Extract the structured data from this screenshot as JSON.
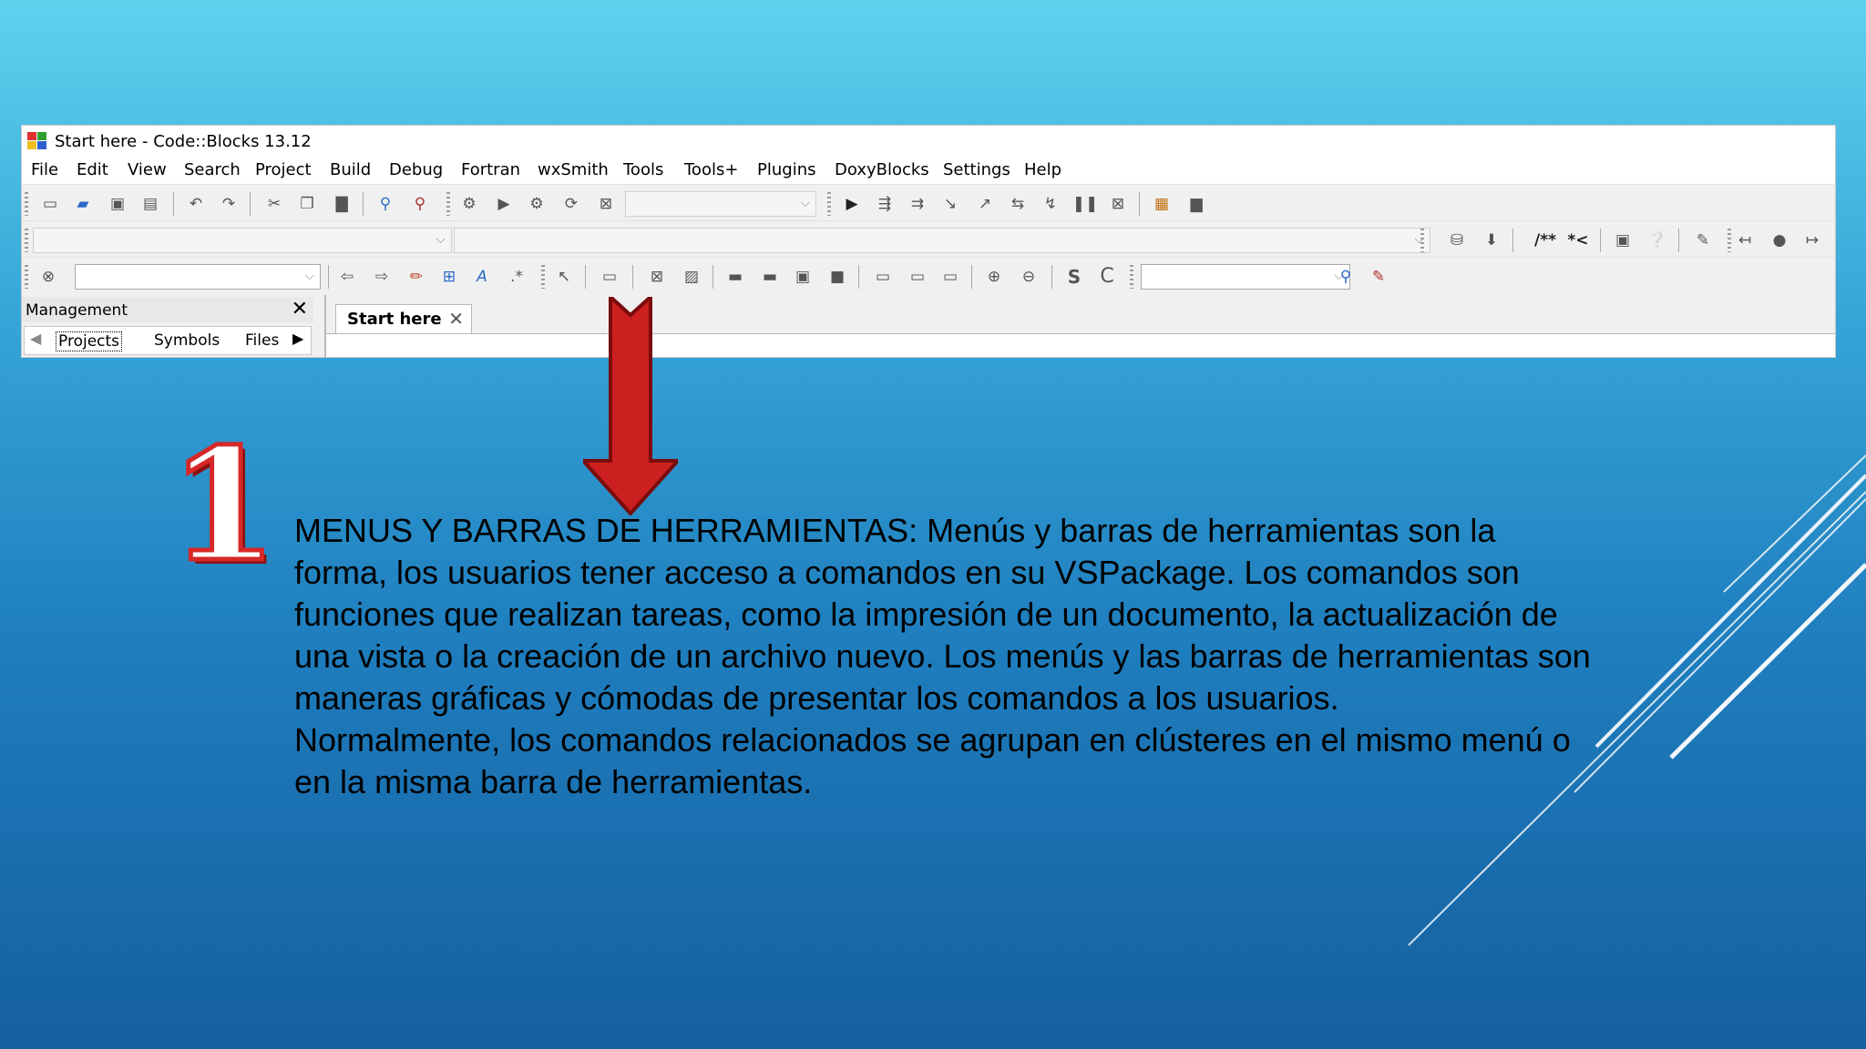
{
  "window": {
    "title": "Start here - Code::Blocks 13.12"
  },
  "menubar": {
    "items": [
      "File",
      "Edit",
      "View",
      "Search",
      "Project",
      "Build",
      "Debug",
      "Fortran",
      "wxSmith",
      "Tools",
      "Tools+",
      "Plugins",
      "DoxyBlocks",
      "Settings",
      "Help"
    ]
  },
  "toolbar": {
    "doxy_comment_block": "/**",
    "doxy_line_comment": "*<",
    "strike_label": "S",
    "copy_label": "C"
  },
  "management": {
    "title": "Management",
    "close": "✕",
    "tabs": [
      "Projects",
      "Symbols",
      "Files"
    ],
    "active_tab": "Projects"
  },
  "editor": {
    "tab_label": "Start here",
    "tab_close": "✕"
  },
  "slide": {
    "step_number": "1",
    "paragraph1": "MENUS Y BARRAS DE HERRAMIENTAS: Menús y barras de herramientas son la forma, los usuarios tener acceso a comandos en su VSPackage. Los comandos son funciones que realizan tareas, como la impresión de un documento, la actualización de una vista o la creación de un archivo nuevo. Los menús y las barras de herramientas son maneras gráficas y cómodas de presentar los comandos a los usuarios.",
    "paragraph2": "Normalmente, los comandos relacionados se agrupan en clústeres en el mismo menú o en la misma barra de herramientas."
  },
  "colors": {
    "background_top": "#5fd2ee",
    "background_bottom": "#155f9f",
    "arrow_red": "#cc2020",
    "number_red": "#d62828"
  }
}
